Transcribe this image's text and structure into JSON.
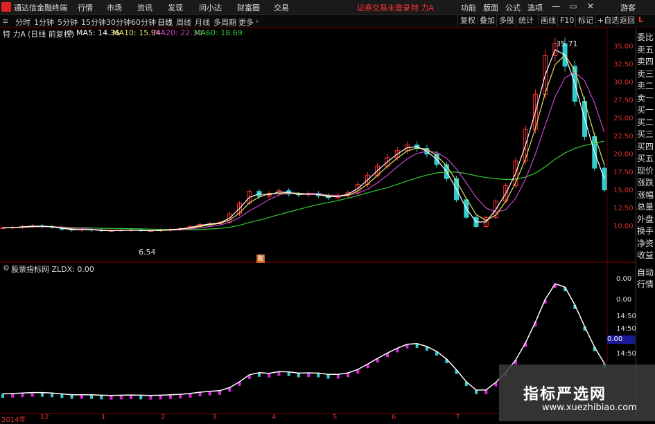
{
  "menubar": {
    "app_title": "通达信金融终端",
    "items": [
      "行情",
      "市场",
      "资讯",
      "发现",
      "问小达",
      "财富圈",
      "交易"
    ],
    "login_status": "证券交易未登录",
    "stock": "特 力A",
    "right_items": [
      "功能",
      "版面",
      "公式",
      "选项"
    ],
    "guest": "游客"
  },
  "periodbar": {
    "periods": [
      "分时",
      "1分钟",
      "5分钟",
      "15分钟",
      "30分钟",
      "60分钟",
      "日线",
      "周线",
      "月线",
      "多周期",
      "更多"
    ],
    "active": "日线",
    "tools": [
      "复权",
      "叠加",
      "多股",
      "统计",
      "画线",
      "F10",
      "标记",
      "+自选",
      "返回"
    ]
  },
  "main_chart": {
    "stock_label": "特 力A",
    "mode": "(日线 前复权)",
    "ma5": "MA5: 14.36",
    "ma10": "MA10: 15.94",
    "ma20": "MA20: 22.30",
    "ma60": "MA60: 18.69",
    "high_label": "35.71",
    "low_label": "6.54",
    "badge": "腥",
    "y_ticks": [
      "35.00",
      "32.50",
      "30.00",
      "27.50",
      "25.00",
      "22.50",
      "20.00",
      "17.50",
      "15.00",
      "12.50",
      "10.00"
    ]
  },
  "sub_chart": {
    "indicator": "股票指标网 ZLDX: 0.00",
    "y_ticks": [
      "0.00",
      "0.00",
      "14:50",
      "14:50",
      "14:50",
      "14:50",
      "14:50",
      "14:50"
    ],
    "current": "0.00"
  },
  "side_panel": {
    "top": "L",
    "labels": [
      "委比",
      "卖五",
      "卖四",
      "卖三",
      "卖二",
      "卖一",
      "买一",
      "买二",
      "买三",
      "买四",
      "买五",
      "现价",
      "涨跌",
      "涨幅",
      "总量",
      "外盘",
      "换手",
      "净资",
      "收益"
    ],
    "lower": [
      "自动",
      "行情"
    ]
  },
  "dates": [
    "2014年",
    "12",
    "1",
    "2",
    "3",
    "4",
    "5",
    "6",
    "7"
  ],
  "watermark": {
    "title": "指标严选网",
    "url": "www.xuezhibiao.com"
  },
  "colors": {
    "up": "#ff3333",
    "down": "#33cccc",
    "ma5": "#ffffff",
    "ma10": "#e8e060",
    "ma20": "#cc44cc",
    "ma60": "#33cc33"
  },
  "chart_data": {
    "type": "candlestick",
    "ylim": [
      6,
      36
    ],
    "close": [
      9.0,
      9.1,
      9.2,
      9.3,
      9.2,
      9.1,
      8.8,
      8.7,
      8.8,
      8.7,
      8.6,
      8.6,
      8.7,
      8.7,
      8.6,
      8.6,
      8.7,
      8.8,
      8.9,
      9.2,
      9.5,
      9.6,
      9.8,
      11.0,
      12.5,
      14.2,
      13.5,
      13.9,
      14.3,
      13.8,
      13.7,
      13.9,
      13.6,
      13.3,
      13.6,
      14.0,
      15.2,
      16.5,
      17.8,
      19.0,
      20.0,
      20.8,
      20.3,
      19.5,
      18.0,
      16.0,
      13.0,
      10.5,
      9.2,
      10.5,
      12.8,
      15.0,
      18.5,
      23.0,
      28.0,
      33.5,
      35.2,
      32.0,
      27.0,
      22.0,
      17.5,
      14.4
    ]
  }
}
